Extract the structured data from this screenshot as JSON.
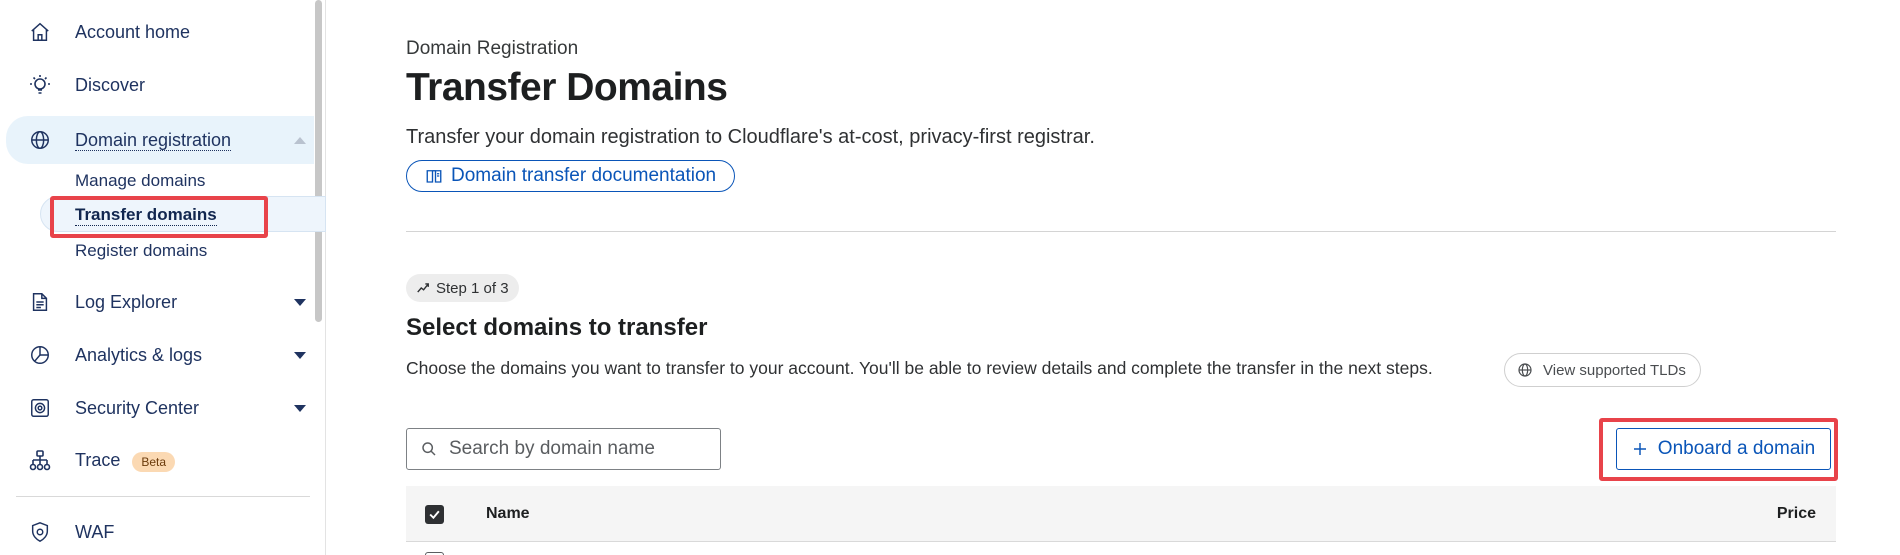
{
  "sidebar": {
    "items": [
      {
        "label": "Account home",
        "icon": "home-icon"
      },
      {
        "label": "Discover",
        "icon": "lightbulb-icon"
      },
      {
        "label": "Domain registration",
        "icon": "globe-icon"
      },
      {
        "label": "Log Explorer",
        "icon": "log-file-icon"
      },
      {
        "label": "Analytics & logs",
        "icon": "pie-chart-icon"
      },
      {
        "label": "Security Center",
        "icon": "security-center-icon"
      },
      {
        "label": "Trace",
        "icon": "trace-icon",
        "badge": "Beta"
      },
      {
        "label": "WAF",
        "icon": "shield-icon"
      }
    ],
    "sub_items": [
      {
        "label": "Manage domains"
      },
      {
        "label": "Transfer domains"
      },
      {
        "label": "Register domains"
      }
    ]
  },
  "main": {
    "eyebrow": "Domain Registration",
    "title": "Transfer Domains",
    "description": "Transfer your domain registration to Cloudflare's at-cost, privacy-first registrar.",
    "doc_link": "Domain transfer documentation",
    "step": "Step 1 of 3",
    "section_title": "Select domains to transfer",
    "section_desc": "Choose the domains you want to transfer to your account. You'll be able to review details and complete the transfer in the next steps.",
    "tld_button": "View supported TLDs",
    "search_placeholder": "Search by domain name",
    "onboard_button": "Onboard a domain",
    "table": {
      "columns": [
        "Name",
        "Price"
      ]
    }
  },
  "colors": {
    "accent": "#0a55b8",
    "highlight": "#e8434a",
    "nav_text": "#1f3360",
    "active_bg": "#e8f3fb",
    "beta_bg": "#fbd9b3"
  }
}
